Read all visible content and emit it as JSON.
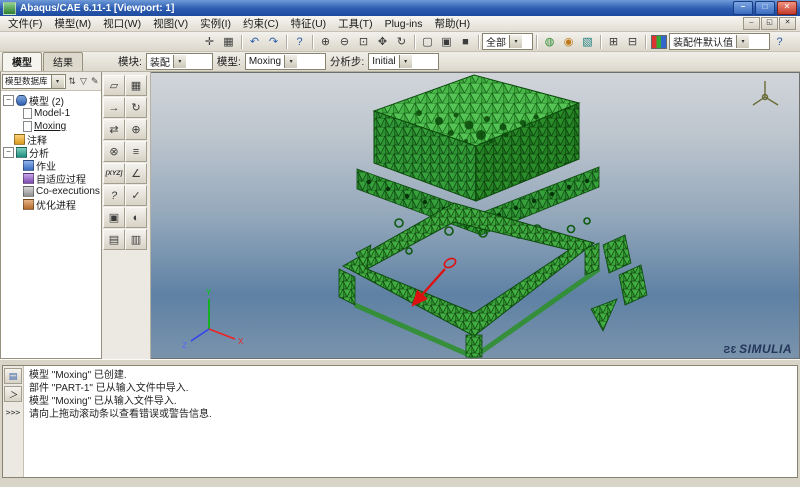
{
  "window": {
    "title": "Abaqus/CAE 6.11-1 [Viewport: 1]"
  },
  "menubar": {
    "items": [
      "文件(F)",
      "模型(M)",
      "视口(W)",
      "视图(V)",
      "实例(I)",
      "约束(C)",
      "特征(U)",
      "工具(T)",
      "Plug-ins",
      "帮助(H)"
    ]
  },
  "toolbar": {
    "scope_combo": "全部",
    "color_combo": "装配件默认值"
  },
  "context": {
    "module_label": "模块:",
    "module_value": "装配",
    "model_label": "模型:",
    "model_value": "Moxing",
    "step_label": "分析步:",
    "step_value": "Initial"
  },
  "left_panel": {
    "tabs": [
      "模型",
      "结果"
    ],
    "db_combo": "模型数据库",
    "tree": [
      "模型 (2)",
      "Model-1",
      "Moxing",
      "注释",
      "分析",
      "作业",
      "自适应过程",
      "Co-executions",
      "优化进程"
    ]
  },
  "toolbox": {
    "xyz_label": "[XYZ]"
  },
  "viewport": {
    "axis_x": "X",
    "axis_y": "Y",
    "axis_z": "Z",
    "watermark_logo": "3S",
    "watermark_text": "SIMULIA"
  },
  "messages": {
    "lines": [
      "模型 \"Moxing\" 已创建.",
      "部件 \"PART-1\" 已从输入文件中导入.",
      "模型 \"Moxing\" 已从输入文件导入.",
      "请向上拖动滚动条以查看错误或警告信息."
    ],
    "prompt": ">>>"
  },
  "icons": {
    "minimize": "–",
    "maximize": "□",
    "restore": "◱",
    "close": "✕",
    "combo_arrow": "▾",
    "expander": "−",
    "move": "✛",
    "grid": "▦",
    "undo": "↶",
    "redo": "↷",
    "query": "?",
    "zoom_in": "⊕",
    "zoom_out": "⊖",
    "zoom_fit": "⊡",
    "pan": "✥",
    "rotate": "↻",
    "wireframe": "▢",
    "hidden_line": "▣",
    "shaded": "■",
    "vis_a": "◍",
    "vis_b": "◉",
    "vis_c": "▧",
    "vp_new": "⊞",
    "vp_tile": "⊟",
    "help": "?",
    "tree_collapse": "⇅",
    "tree_filter": "▽",
    "tree_edit": "✎",
    "tb1": "▱",
    "tb2": "▦",
    "tb3": "→",
    "tb4": "↻",
    "tb5": "⇄",
    "tb6": "⊕",
    "tb7": "⊗",
    "tb8": "≡",
    "tb10": "∠",
    "tb11": "?",
    "tb12": "✓",
    "tb13": "▣",
    "tb14": "◐",
    "tb15": "▤",
    "tb16": "▥",
    "msg_tab": "▤",
    "cli_tab": "＞"
  },
  "colors": {
    "titlebar": "#2b5bb0",
    "mesh_green": "#3aa33a",
    "mesh_edge": "#0d4a0d",
    "viewport_top": "#d1d5da",
    "viewport_bottom": "#5e81a4",
    "highlight_red": "#dd1111"
  }
}
